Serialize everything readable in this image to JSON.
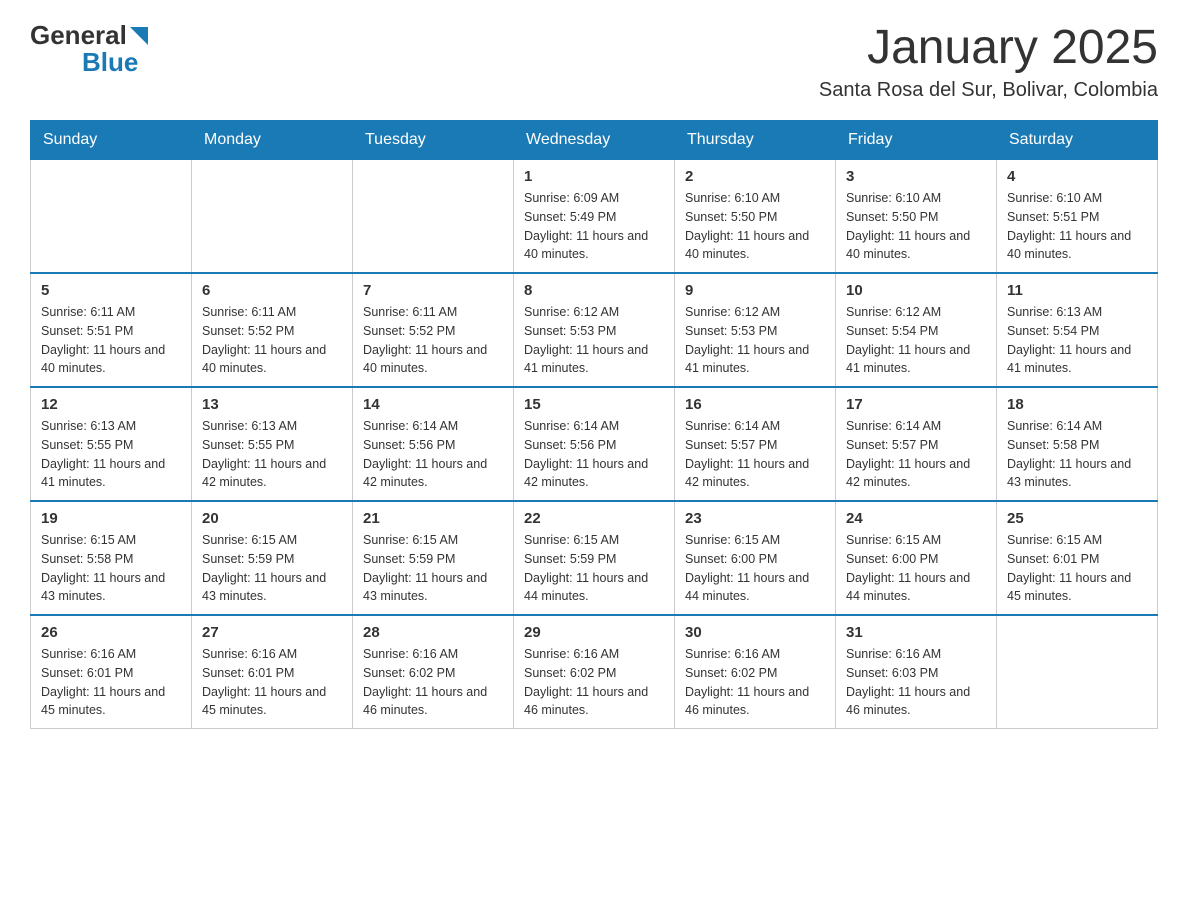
{
  "logo": {
    "general": "General",
    "blue": "Blue"
  },
  "title": "January 2025",
  "subtitle": "Santa Rosa del Sur, Bolivar, Colombia",
  "days_of_week": [
    "Sunday",
    "Monday",
    "Tuesday",
    "Wednesday",
    "Thursday",
    "Friday",
    "Saturday"
  ],
  "weeks": [
    [
      {
        "day": "",
        "info": ""
      },
      {
        "day": "",
        "info": ""
      },
      {
        "day": "",
        "info": ""
      },
      {
        "day": "1",
        "info": "Sunrise: 6:09 AM\nSunset: 5:49 PM\nDaylight: 11 hours and 40 minutes."
      },
      {
        "day": "2",
        "info": "Sunrise: 6:10 AM\nSunset: 5:50 PM\nDaylight: 11 hours and 40 minutes."
      },
      {
        "day": "3",
        "info": "Sunrise: 6:10 AM\nSunset: 5:50 PM\nDaylight: 11 hours and 40 minutes."
      },
      {
        "day": "4",
        "info": "Sunrise: 6:10 AM\nSunset: 5:51 PM\nDaylight: 11 hours and 40 minutes."
      }
    ],
    [
      {
        "day": "5",
        "info": "Sunrise: 6:11 AM\nSunset: 5:51 PM\nDaylight: 11 hours and 40 minutes."
      },
      {
        "day": "6",
        "info": "Sunrise: 6:11 AM\nSunset: 5:52 PM\nDaylight: 11 hours and 40 minutes."
      },
      {
        "day": "7",
        "info": "Sunrise: 6:11 AM\nSunset: 5:52 PM\nDaylight: 11 hours and 40 minutes."
      },
      {
        "day": "8",
        "info": "Sunrise: 6:12 AM\nSunset: 5:53 PM\nDaylight: 11 hours and 41 minutes."
      },
      {
        "day": "9",
        "info": "Sunrise: 6:12 AM\nSunset: 5:53 PM\nDaylight: 11 hours and 41 minutes."
      },
      {
        "day": "10",
        "info": "Sunrise: 6:12 AM\nSunset: 5:54 PM\nDaylight: 11 hours and 41 minutes."
      },
      {
        "day": "11",
        "info": "Sunrise: 6:13 AM\nSunset: 5:54 PM\nDaylight: 11 hours and 41 minutes."
      }
    ],
    [
      {
        "day": "12",
        "info": "Sunrise: 6:13 AM\nSunset: 5:55 PM\nDaylight: 11 hours and 41 minutes."
      },
      {
        "day": "13",
        "info": "Sunrise: 6:13 AM\nSunset: 5:55 PM\nDaylight: 11 hours and 42 minutes."
      },
      {
        "day": "14",
        "info": "Sunrise: 6:14 AM\nSunset: 5:56 PM\nDaylight: 11 hours and 42 minutes."
      },
      {
        "day": "15",
        "info": "Sunrise: 6:14 AM\nSunset: 5:56 PM\nDaylight: 11 hours and 42 minutes."
      },
      {
        "day": "16",
        "info": "Sunrise: 6:14 AM\nSunset: 5:57 PM\nDaylight: 11 hours and 42 minutes."
      },
      {
        "day": "17",
        "info": "Sunrise: 6:14 AM\nSunset: 5:57 PM\nDaylight: 11 hours and 42 minutes."
      },
      {
        "day": "18",
        "info": "Sunrise: 6:14 AM\nSunset: 5:58 PM\nDaylight: 11 hours and 43 minutes."
      }
    ],
    [
      {
        "day": "19",
        "info": "Sunrise: 6:15 AM\nSunset: 5:58 PM\nDaylight: 11 hours and 43 minutes."
      },
      {
        "day": "20",
        "info": "Sunrise: 6:15 AM\nSunset: 5:59 PM\nDaylight: 11 hours and 43 minutes."
      },
      {
        "day": "21",
        "info": "Sunrise: 6:15 AM\nSunset: 5:59 PM\nDaylight: 11 hours and 43 minutes."
      },
      {
        "day": "22",
        "info": "Sunrise: 6:15 AM\nSunset: 5:59 PM\nDaylight: 11 hours and 44 minutes."
      },
      {
        "day": "23",
        "info": "Sunrise: 6:15 AM\nSunset: 6:00 PM\nDaylight: 11 hours and 44 minutes."
      },
      {
        "day": "24",
        "info": "Sunrise: 6:15 AM\nSunset: 6:00 PM\nDaylight: 11 hours and 44 minutes."
      },
      {
        "day": "25",
        "info": "Sunrise: 6:15 AM\nSunset: 6:01 PM\nDaylight: 11 hours and 45 minutes."
      }
    ],
    [
      {
        "day": "26",
        "info": "Sunrise: 6:16 AM\nSunset: 6:01 PM\nDaylight: 11 hours and 45 minutes."
      },
      {
        "day": "27",
        "info": "Sunrise: 6:16 AM\nSunset: 6:01 PM\nDaylight: 11 hours and 45 minutes."
      },
      {
        "day": "28",
        "info": "Sunrise: 6:16 AM\nSunset: 6:02 PM\nDaylight: 11 hours and 46 minutes."
      },
      {
        "day": "29",
        "info": "Sunrise: 6:16 AM\nSunset: 6:02 PM\nDaylight: 11 hours and 46 minutes."
      },
      {
        "day": "30",
        "info": "Sunrise: 6:16 AM\nSunset: 6:02 PM\nDaylight: 11 hours and 46 minutes."
      },
      {
        "day": "31",
        "info": "Sunrise: 6:16 AM\nSunset: 6:03 PM\nDaylight: 11 hours and 46 minutes."
      },
      {
        "day": "",
        "info": ""
      }
    ]
  ]
}
